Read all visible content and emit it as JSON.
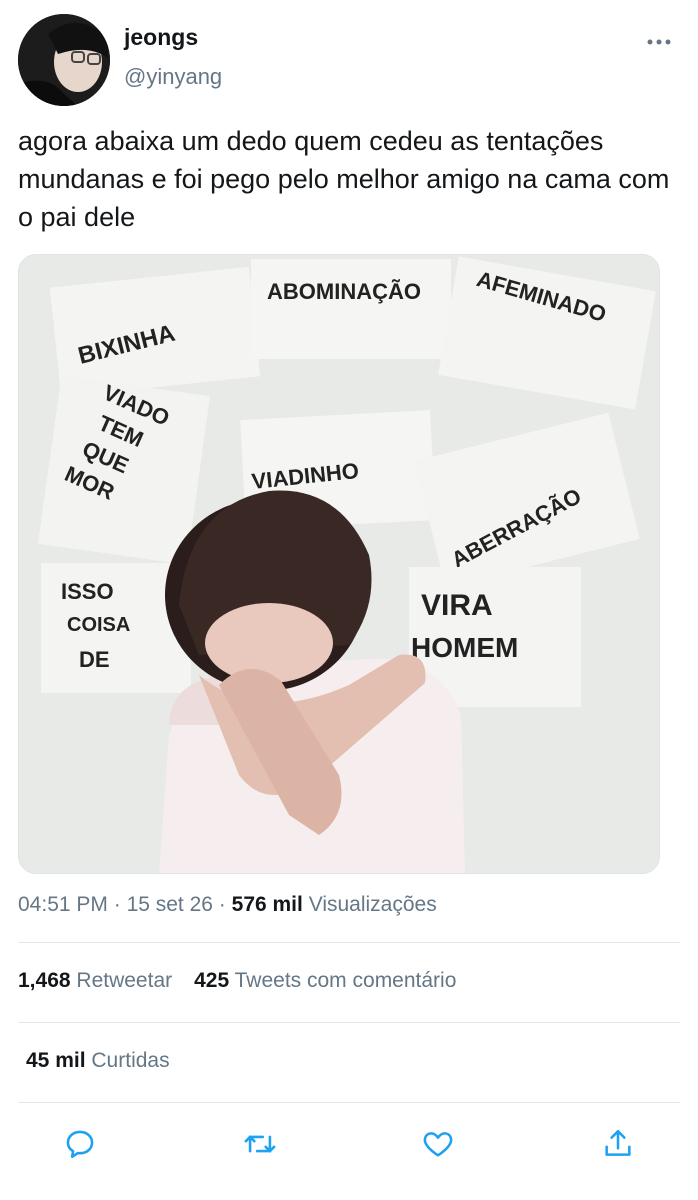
{
  "user": {
    "name": "jeongs",
    "handle": "@yinyang"
  },
  "tweet": {
    "text": "agora abaixa um dedo quem cedeu as tentações mundanas e foi pego pelo melhor amigo na cama com o pai dele"
  },
  "media": {
    "papers": [
      "BIXINHA",
      "ABOMINAÇÃO",
      "AFEMINADO",
      "VIADO",
      "TEM",
      "QUE",
      "MOR",
      "VIADINHO",
      "ABERRAÇÃO",
      "ISSO",
      "COISA",
      "DE",
      "VIRA",
      "HOMEM"
    ]
  },
  "meta": {
    "time": "04:51 PM",
    "sep1": " · ",
    "date": "15 set 26",
    "sep2": " · ",
    "views_count": "576 mil",
    "views_label": "Visualizações"
  },
  "stats": {
    "retweets_count": "1,468",
    "retweets_label": "Retweetar",
    "quotes_count": "425",
    "quotes_label": "Tweets com comentário",
    "likes_count": "45 mil",
    "likes_label": "Curtidas"
  },
  "icons": {
    "reply": "reply-icon",
    "retweet": "retweet-icon",
    "like": "heart-icon",
    "share": "share-icon",
    "more": "more-icon"
  },
  "colors": {
    "text": "#14171a",
    "secondary": "#657786",
    "divider": "#e1e8ed",
    "icon": "#1da1f2"
  }
}
